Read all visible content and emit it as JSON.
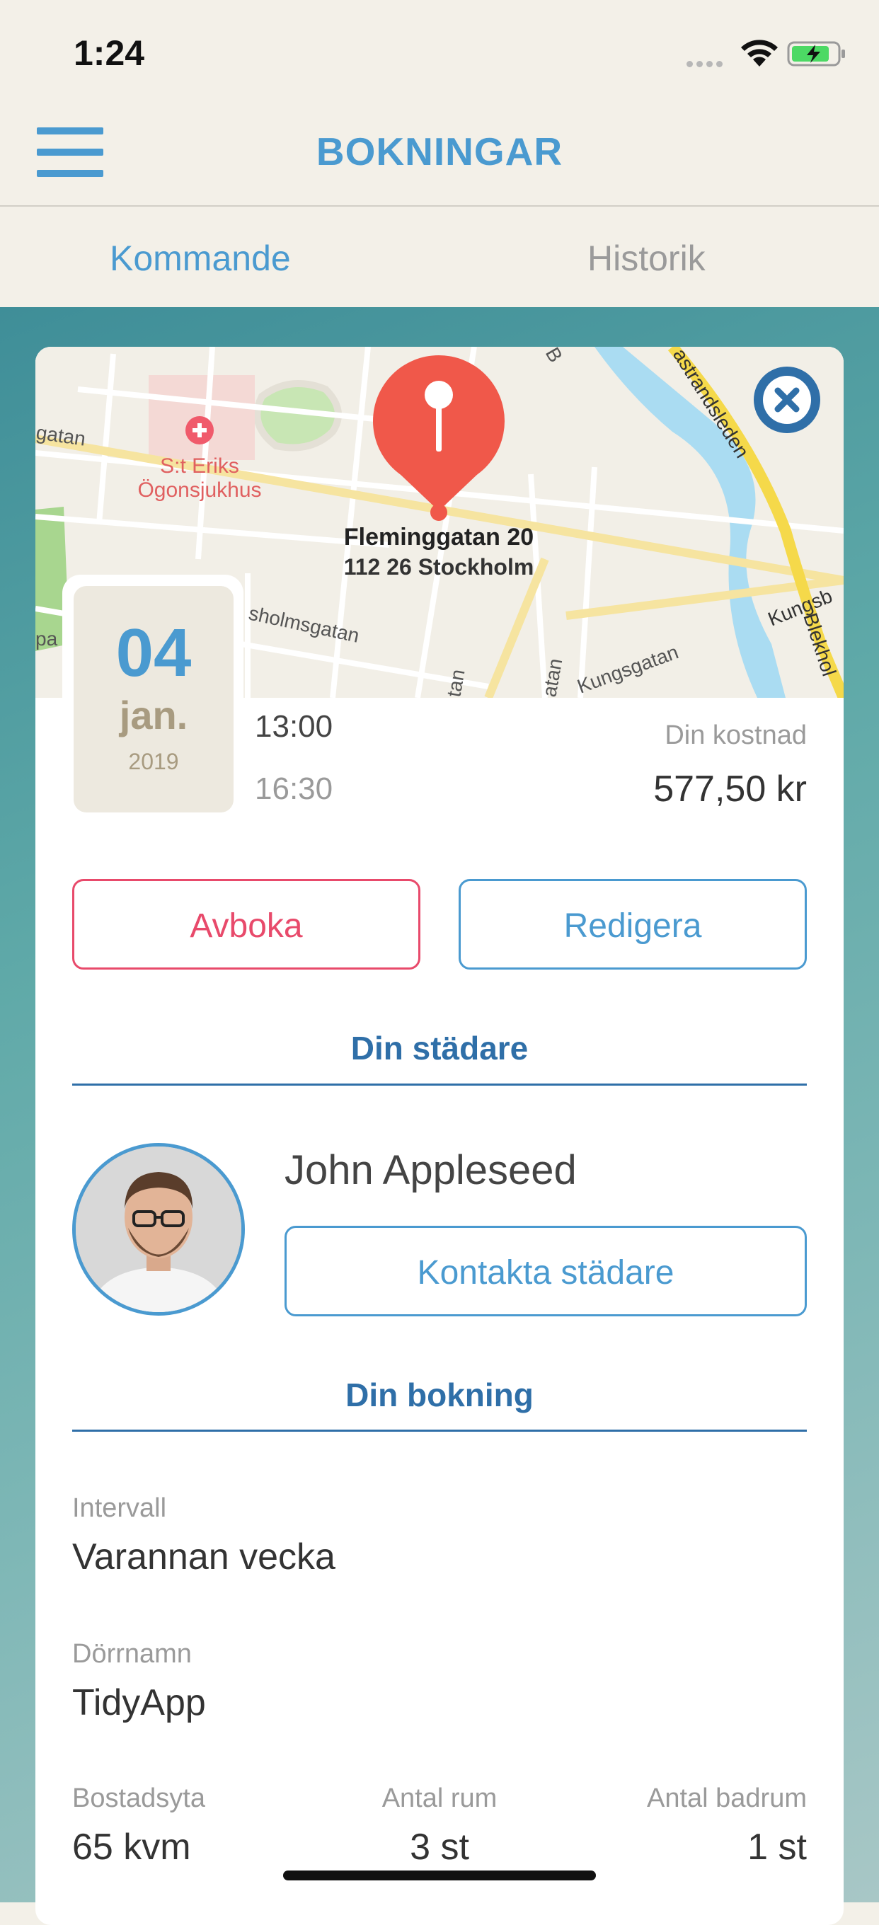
{
  "status_bar": {
    "time": "1:24"
  },
  "nav": {
    "title": "BOKNINGAR"
  },
  "tabs": [
    {
      "label": "Kommande",
      "active": true
    },
    {
      "label": "Historik",
      "active": false
    }
  ],
  "map": {
    "pin_address_line1": "Fleminggatan 20",
    "pin_address_line2": "112 26 Stockholm",
    "poi_line1": "S:t Eriks",
    "poi_line2": "Ögonsjukhus",
    "streets": [
      "gatan",
      "sholmsgatan",
      "Kungsgatan",
      "Kungsb",
      "astrandsleden",
      "Blekhol",
      "tan",
      "atan",
      "pa",
      "B"
    ]
  },
  "booking": {
    "day": "04",
    "month": "jan.",
    "year": "2019",
    "start_time": "13:00",
    "end_time": "16:30",
    "cost_label": "Din kostnad",
    "cost_value": "577,50 kr",
    "cancel_label": "Avboka",
    "edit_label": "Redigera"
  },
  "cleaner": {
    "section_title": "Din städare",
    "name": "John Appleseed",
    "contact_label": "Kontakta städare"
  },
  "details": {
    "section_title": "Din bokning",
    "interval_label": "Intervall",
    "interval_value": "Varannan vecka",
    "door_label": "Dörrnamn",
    "door_value": "TidyApp",
    "area_label": "Bostadsyta",
    "area_value": "65 kvm",
    "rooms_label": "Antal rum",
    "rooms_value": "3 st",
    "bathrooms_label": "Antal badrum",
    "bathrooms_value": "1 st"
  },
  "colors": {
    "accent": "#4a9ad0",
    "accent_dark": "#2f6fa8",
    "danger": "#e84a6b",
    "pin": "#f0584a",
    "background": "#f3f0e8"
  }
}
